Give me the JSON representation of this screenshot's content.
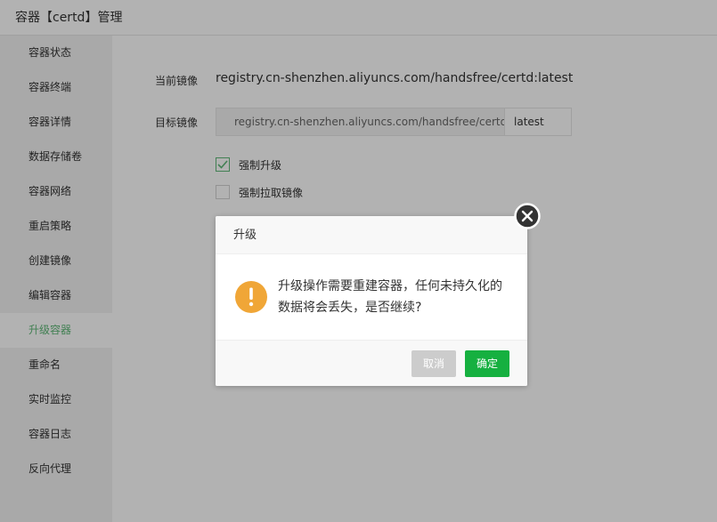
{
  "header": {
    "title": "容器【certd】管理"
  },
  "sidebar": {
    "items": [
      {
        "label": "容器状态"
      },
      {
        "label": "容器终端"
      },
      {
        "label": "容器详情"
      },
      {
        "label": "数据存储卷"
      },
      {
        "label": "容器网络"
      },
      {
        "label": "重启策略"
      },
      {
        "label": "创建镜像"
      },
      {
        "label": "编辑容器"
      },
      {
        "label": "升级容器"
      },
      {
        "label": "重命名"
      },
      {
        "label": "实时监控"
      },
      {
        "label": "容器日志"
      },
      {
        "label": "反向代理"
      }
    ],
    "active_index": 8
  },
  "form": {
    "current_image_label": "当前镜像",
    "current_image_value": "registry.cn-shenzhen.aliyuncs.com/handsfree/certd:latest",
    "target_image_label": "目标镜像",
    "target_image_value": "registry.cn-shenzhen.aliyuncs.com/handsfree/certd",
    "target_tag_value": "latest",
    "force_upgrade_label": "强制升级",
    "force_upgrade_checked": true,
    "force_pull_label": "强制拉取镜像",
    "force_pull_checked": false
  },
  "dialog": {
    "title": "升级",
    "message": "升级操作需要重建容器，任何未持久化的数据将会丢失，是否继续?",
    "cancel_label": "取消",
    "ok_label": "确定",
    "icon": "warning-icon",
    "close_icon": "close-icon"
  },
  "colors": {
    "accent_green": "#5FB878",
    "ok_button": "#16b040",
    "warning": "#f0a637"
  }
}
